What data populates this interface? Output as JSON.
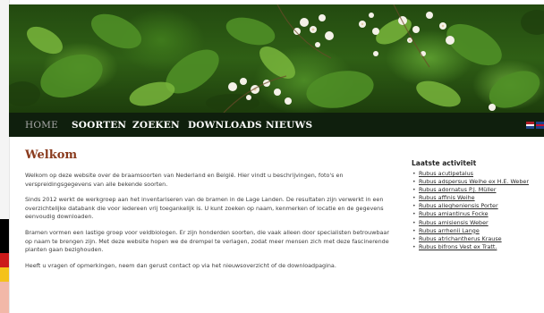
{
  "nav": {
    "items": [
      {
        "label": "HOME",
        "active": true
      },
      {
        "label": "SOORTEN",
        "active": false
      },
      {
        "label": "ZOEKEN",
        "active": false
      },
      {
        "label": "DOWNLOADS",
        "active": false
      },
      {
        "label": "NIEUWS",
        "active": false
      }
    ],
    "flags": [
      "dutch-flag-icon",
      "english-flag-icon"
    ]
  },
  "main": {
    "title": "Welkom",
    "paragraphs": [
      "Welkom op deze website over de braamsoorten van Nederland en België. Hier vindt u beschrijvingen, foto's en verspreidingsgegevens van alle bekende soorten.",
      "Sinds 2012 werkt de werkgroep aan het inventariseren van de bramen in de Lage Landen. De resultaten zijn verwerkt in een overzichtelijke databank die voor iedereen vrij toegankelijk is. U kunt zoeken op naam, kenmerken of locatie en de gegevens eenvoudig downloaden.",
      "Bramen vormen een lastige groep voor veldbiologen. Er zijn honderden soorten, die vaak alleen door specialisten betrouwbaar op naam te brengen zijn. Met deze website hopen we de drempel te verlagen, zodat meer mensen zich met deze fascinerende planten gaan bezighouden.",
      "Heeft u vragen of opmerkingen, neem dan gerust contact op via het nieuwsoverzicht of de downloadpagina."
    ]
  },
  "sidebar": {
    "title": "Laatste activiteit",
    "items": [
      "Rubus acutipetalus",
      "Rubus adspersus Weihe ex H.E. Weber",
      "Rubus adornatus P.J. Müller",
      "Rubus affinis Weihe",
      "Rubus allegheniensis Porter",
      "Rubus amiantinus Focke",
      "Rubus amisiensis Weber",
      "Rubus arrhenii Lange",
      "Rubus atrichantherus Krause",
      "Rubus bifrons Vest ex Tratt."
    ]
  },
  "colors": {
    "nav_bg": "#0f1f0d",
    "title": "#8a3b1e",
    "edge_stripes": [
      "#000000",
      "#cc1a1a",
      "#f4c21a",
      "#f2b8a8"
    ]
  }
}
